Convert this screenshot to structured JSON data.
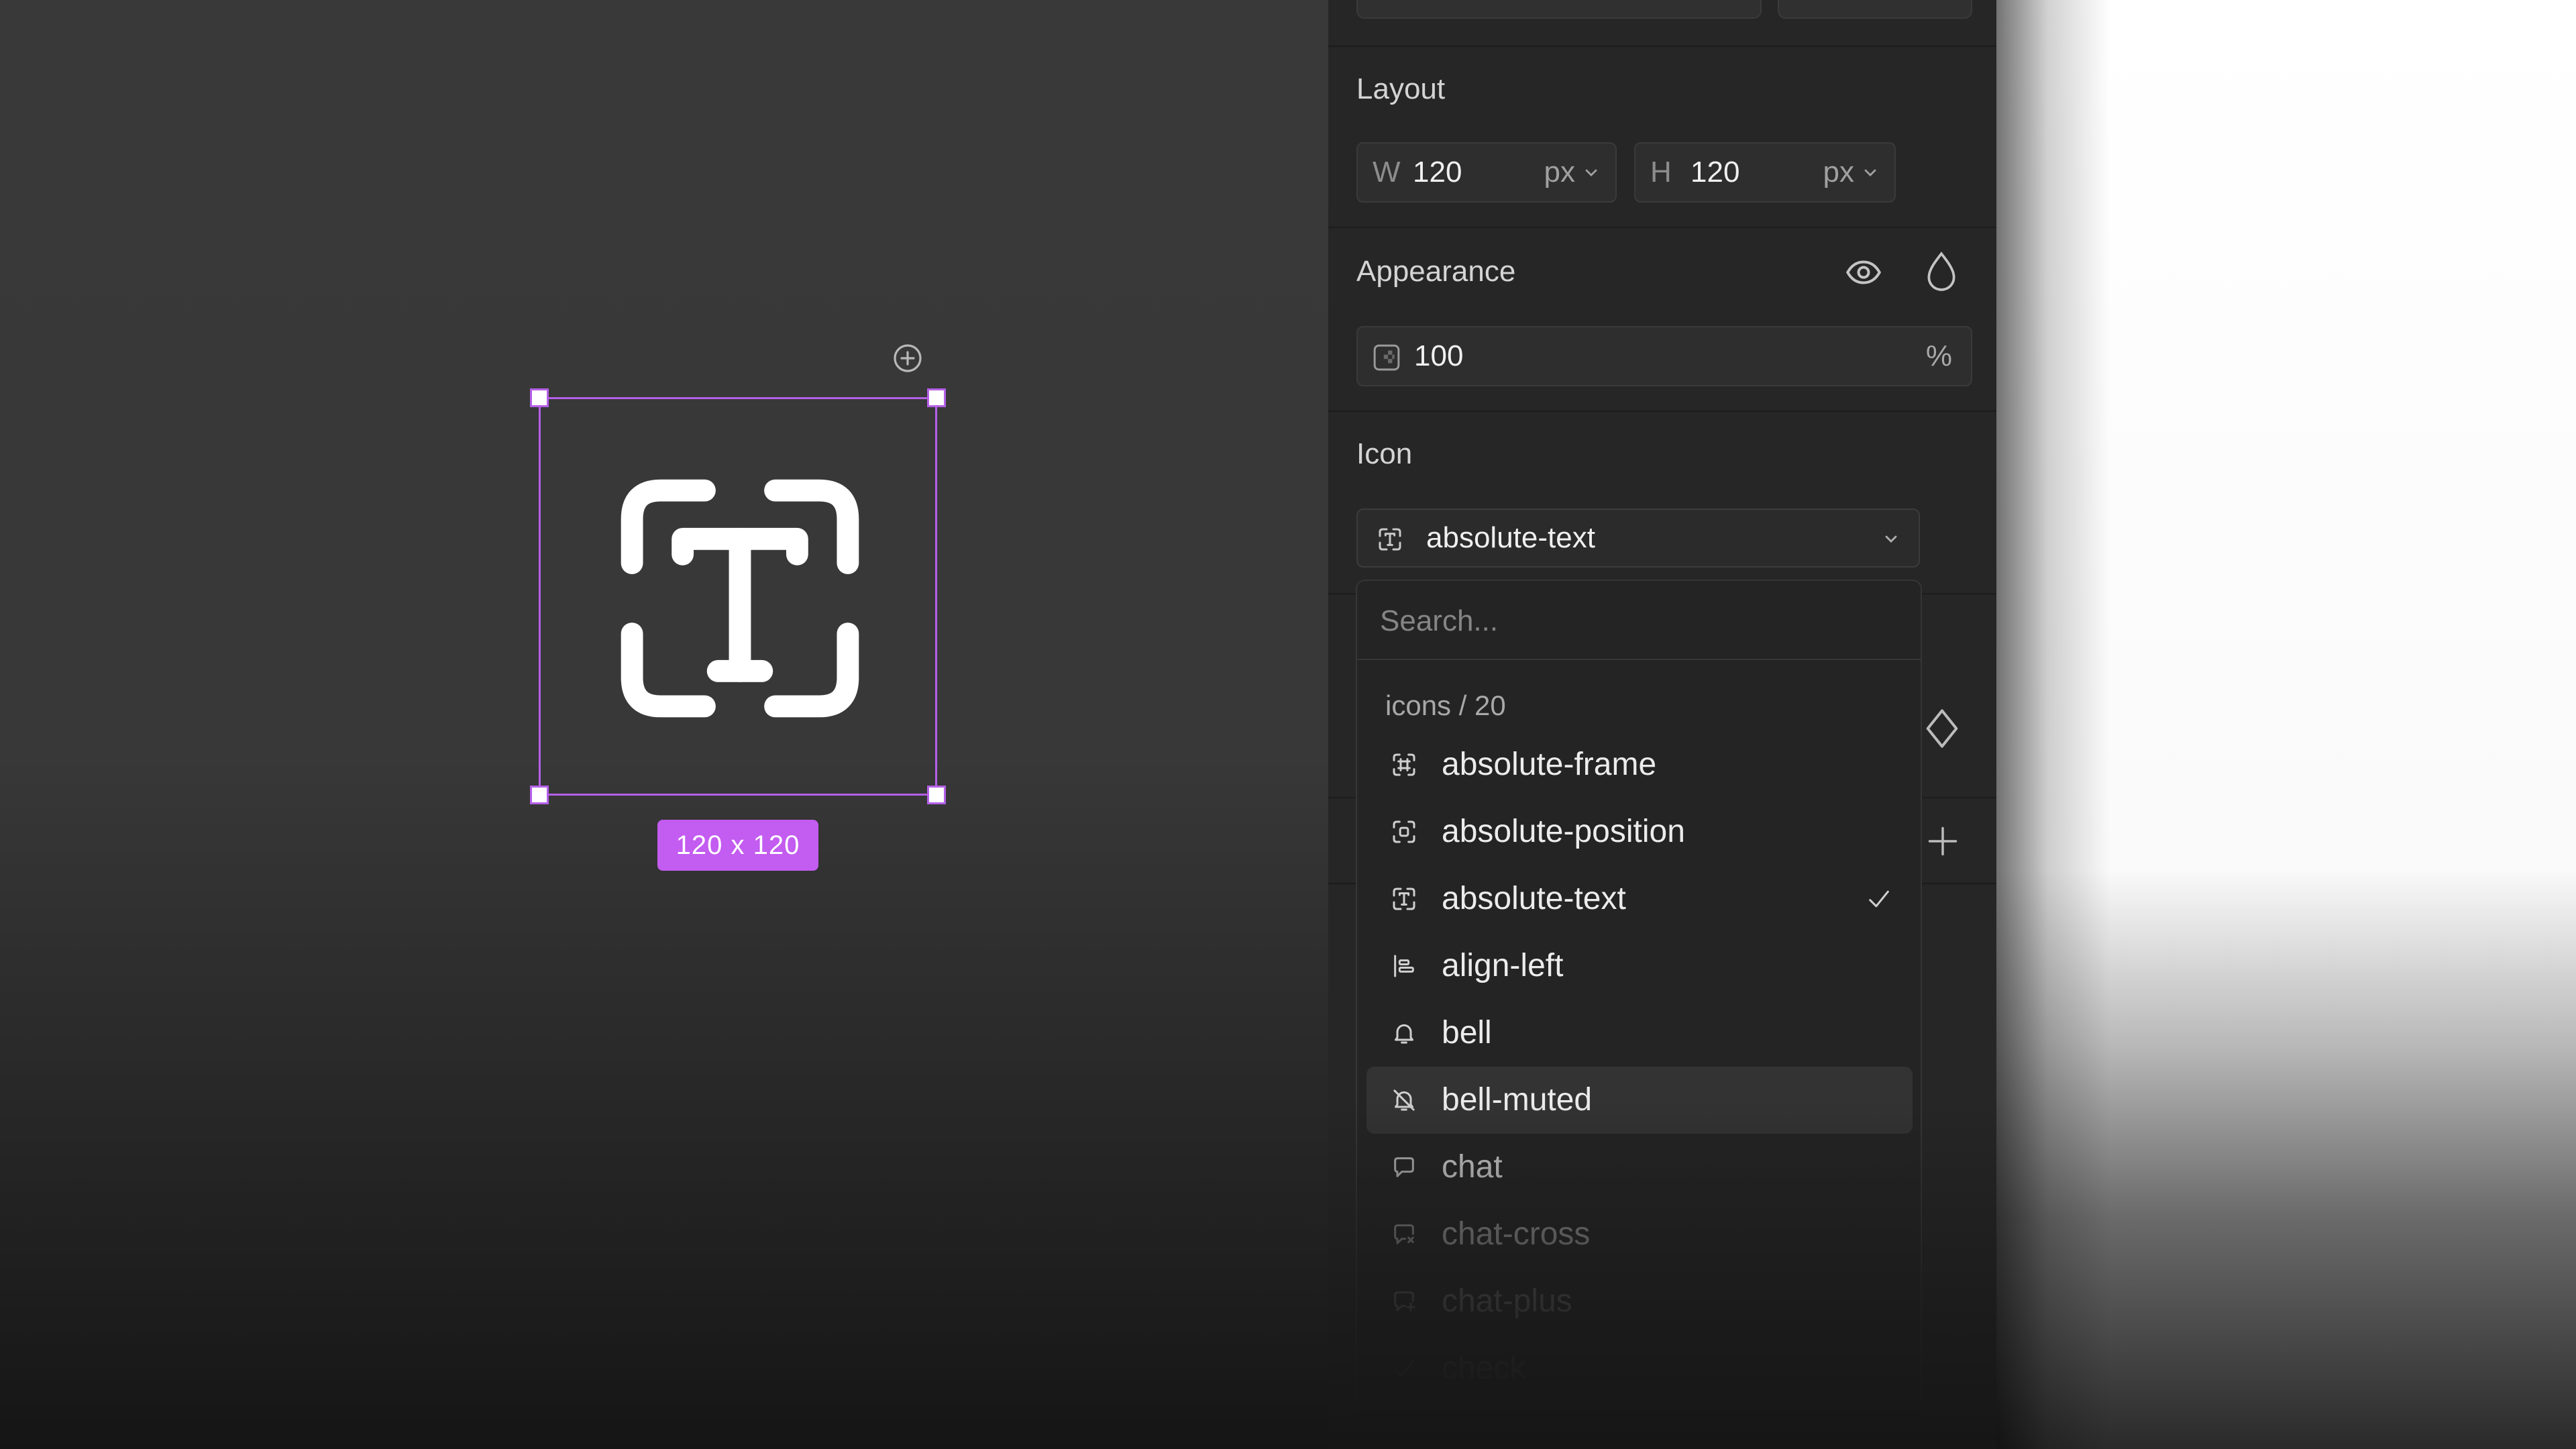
{
  "canvas": {
    "size_label": "120 x 120"
  },
  "panel": {
    "layout": {
      "title": "Layout",
      "width": {
        "prefix": "W",
        "value": "120",
        "unit": "px"
      },
      "height": {
        "prefix": "H",
        "value": "120",
        "unit": "px"
      }
    },
    "appearance": {
      "title": "Appearance",
      "opacity_value": "100",
      "opacity_unit": "%"
    },
    "icon": {
      "title": "Icon",
      "selected": "absolute-text"
    }
  },
  "dropdown": {
    "search_placeholder": "Search...",
    "group_label": "icons / 20",
    "items": [
      {
        "label": "absolute-frame",
        "icon": "absolute-frame-icon"
      },
      {
        "label": "absolute-position",
        "icon": "absolute-position-icon"
      },
      {
        "label": "absolute-text",
        "icon": "absolute-text-icon",
        "checked": true
      },
      {
        "label": "align-left",
        "icon": "align-left-icon"
      },
      {
        "label": "bell",
        "icon": "bell-icon"
      },
      {
        "label": "bell-muted",
        "icon": "bell-muted-icon",
        "hovered": true
      },
      {
        "label": "chat",
        "icon": "chat-icon"
      },
      {
        "label": "chat-cross",
        "icon": "chat-cross-icon"
      },
      {
        "label": "chat-plus",
        "icon": "chat-plus-icon"
      },
      {
        "label": "check",
        "icon": "check-icon"
      }
    ]
  },
  "colors": {
    "selection": "#b460e8",
    "badge": "#c35cf0",
    "panel_bg": "#262626",
    "canvas_bg": "#393939"
  }
}
